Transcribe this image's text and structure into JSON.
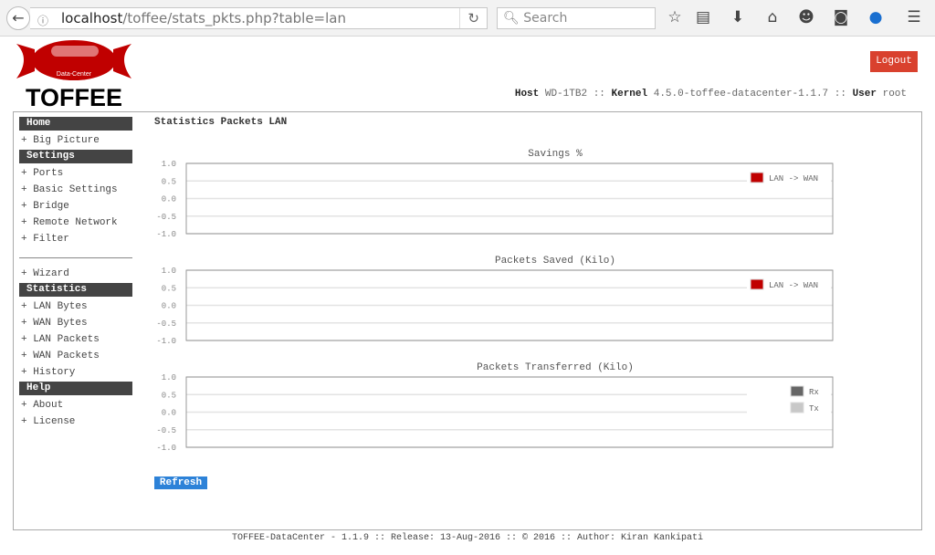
{
  "browser": {
    "url_host": "localhost",
    "url_path": "/toffee/stats_pkts.php?table=lan",
    "search_placeholder": "Search"
  },
  "header": {
    "logo_sub": "Data-Center",
    "logo_text": "TOFFEE",
    "logout": "Logout",
    "host_label": "Host",
    "host": "WD-1TB2",
    "kernel_label": "Kernel",
    "kernel": "4.5.0-toffee-datacenter-1.1.7",
    "user_label": "User",
    "user": "root",
    "sep": "::"
  },
  "sidebar": {
    "groups": [
      {
        "header": "Home",
        "items": [
          "+ Big Picture"
        ]
      },
      {
        "header": "Settings",
        "items": [
          "+ Ports",
          "+ Basic Settings",
          "+ Bridge",
          "+ Remote Network",
          "+ Filter"
        ]
      },
      {
        "header": "",
        "items": [
          "+ Wizard"
        ]
      },
      {
        "header": "Statistics",
        "items": [
          "+ LAN Bytes",
          "+ WAN Bytes",
          "+ LAN Packets",
          "+ WAN Packets",
          "+ History"
        ]
      },
      {
        "header": "Help",
        "items": [
          "+ About",
          "+ License"
        ]
      }
    ]
  },
  "page_title": "Statistics Packets LAN",
  "refresh": "Refresh",
  "footer": "TOFFEE-DataCenter - 1.1.9 :: Release: 13-Aug-2016 :: © 2016 :: Author: Kiran Kankipati",
  "chart_data": [
    {
      "type": "line",
      "title": "Savings %",
      "ylim": [
        -1.0,
        1.0
      ],
      "yticks": [
        "1.0",
        "0.5",
        "0.0",
        "-0.5",
        "-1.0"
      ],
      "grid": true,
      "legend": "top-right",
      "series": [
        {
          "name": "LAN -> WAN",
          "color": "#c00000",
          "values": []
        }
      ]
    },
    {
      "type": "line",
      "title": "Packets Saved (Kilo)",
      "ylim": [
        -1.0,
        1.0
      ],
      "yticks": [
        "1.0",
        "0.5",
        "0.0",
        "-0.5",
        "-1.0"
      ],
      "grid": true,
      "legend": "top-right",
      "series": [
        {
          "name": "LAN -> WAN",
          "color": "#c00000",
          "values": []
        }
      ]
    },
    {
      "type": "line",
      "title": "Packets Transferred (Kilo)",
      "ylim": [
        -1.0,
        1.0
      ],
      "yticks": [
        "1.0",
        "0.5",
        "0.0",
        "-0.5",
        "-1.0"
      ],
      "grid": true,
      "legend": "top-right",
      "series": [
        {
          "name": "Rx",
          "color": "#666666",
          "values": []
        },
        {
          "name": "Tx",
          "color": "#c8c8c8",
          "values": []
        }
      ]
    }
  ]
}
